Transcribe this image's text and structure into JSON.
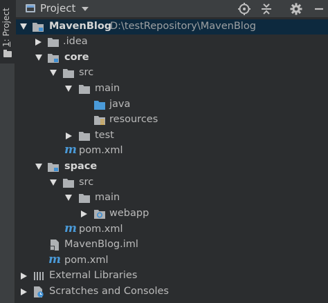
{
  "tool_strip": {
    "tab_number": "1",
    "tab_label": ": Project"
  },
  "header": {
    "title": "Project"
  },
  "tree": {
    "root": {
      "label": "MavenBlog",
      "path": "D:\\testRepository\\MavenBlog"
    },
    "idea": "idea",
    "core": "core",
    "core_src": "src",
    "core_main": "main",
    "core_java": "java",
    "core_resources": "resources",
    "core_test": "test",
    "core_pom": "pom.xml",
    "space": "space",
    "space_src": "src",
    "space_main": "main",
    "space_webapp": "webapp",
    "space_pom": "pom.xml",
    "iml": "MavenBlog.iml",
    "root_pom": "pom.xml",
    "external_libraries": "External Libraries",
    "scratches": "Scratches and Consoles"
  },
  "colors": {
    "selection": "#0d293e",
    "source_folder": "#4a9ad8",
    "module_badge": "#3f8fd2"
  }
}
